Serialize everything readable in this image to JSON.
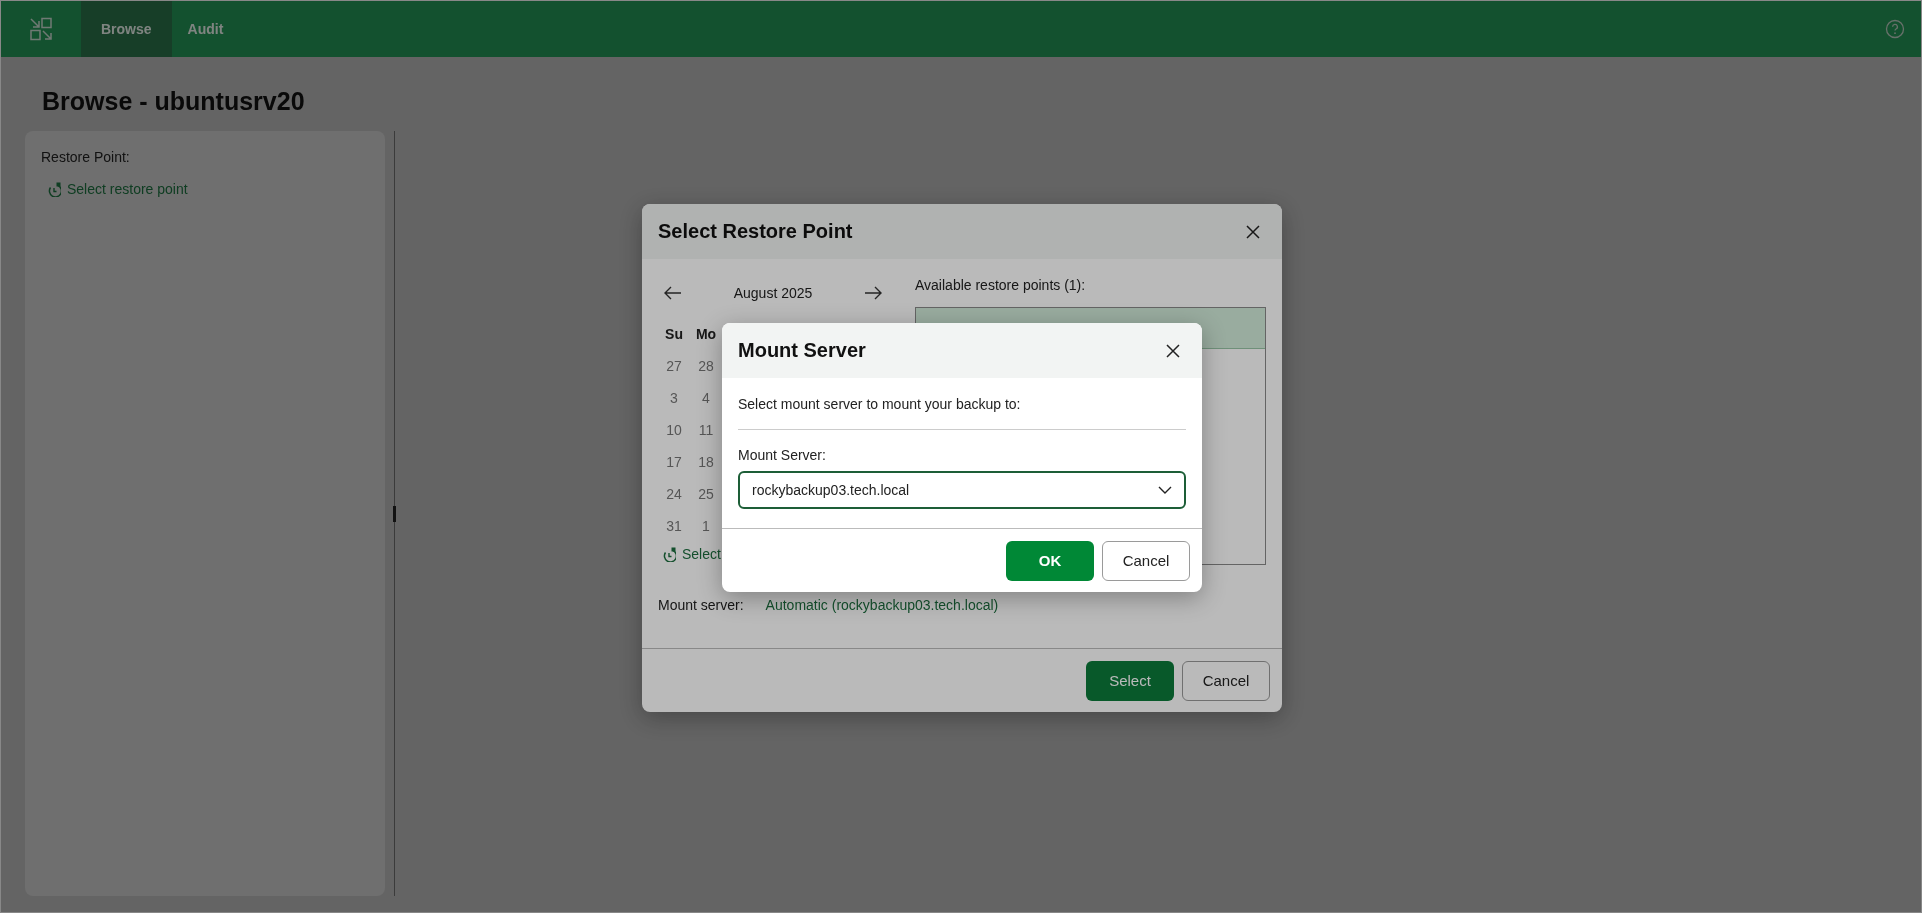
{
  "top_bar": {
    "tabs": [
      {
        "label": "Browse",
        "selected": true
      },
      {
        "label": "Audit",
        "selected": false
      }
    ]
  },
  "page": {
    "title": "Browse - ubuntusrv20"
  },
  "sidebar": {
    "label": "Restore Point:",
    "link": "Select restore point"
  },
  "restore_point_dialog": {
    "title": "Select Restore Point",
    "calendar": {
      "month": "August 2025",
      "weekdays": [
        "Su",
        "Mo"
      ],
      "weeks": [
        [
          "27",
          "28"
        ],
        [
          "3",
          "4"
        ],
        [
          "10",
          "11"
        ],
        [
          "17",
          "18"
        ],
        [
          "24",
          "25"
        ],
        [
          "31",
          "1"
        ]
      ],
      "link": "Select"
    },
    "restore_points": {
      "label": "Available restore points (1):",
      "rows": [
        {
          "selected": true
        }
      ]
    },
    "mount_server": {
      "label": "Mount server:",
      "value": "Automatic (rockybackup03.tech.local)"
    },
    "buttons": [
      {
        "label": "Select",
        "kind": "primary"
      },
      {
        "label": "Cancel",
        "kind": "secondary"
      }
    ]
  },
  "mount_server_dialog": {
    "title": "Mount Server",
    "description": "Select mount server to mount your backup to:",
    "field_label": "Mount Server:",
    "value": "rockybackup03.tech.local",
    "buttons": [
      {
        "label": "OK",
        "kind": "primary"
      },
      {
        "label": "Cancel",
        "kind": "secondary"
      }
    ]
  }
}
